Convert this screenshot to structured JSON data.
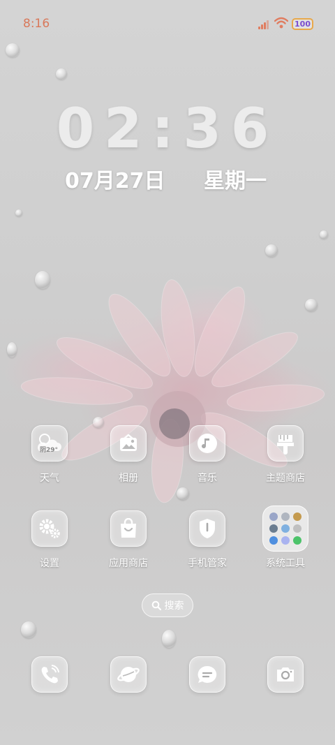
{
  "status_bar": {
    "time": "8:16",
    "battery": "100",
    "colors": {
      "time": "#d9795b",
      "signal": "#e07c5f",
      "wifi": "#e07c5f",
      "battery_border": "#e8a84a",
      "battery_text": "#7a4dd0"
    }
  },
  "lock": {
    "clock": "02:36",
    "date": "07月27日",
    "weekday": "星期一"
  },
  "weather_widget": {
    "temp": "29°",
    "condition": "阴"
  },
  "apps_row1": [
    {
      "label": "天气",
      "icon": "weather-icon"
    },
    {
      "label": "相册",
      "icon": "gallery-icon"
    },
    {
      "label": "音乐",
      "icon": "music-icon"
    },
    {
      "label": "主题商店",
      "icon": "theme-store-icon"
    }
  ],
  "apps_row2": [
    {
      "label": "设置",
      "icon": "gear-icon"
    },
    {
      "label": "应用商店",
      "icon": "app-store-icon"
    },
    {
      "label": "手机管家",
      "icon": "phone-manager-icon"
    },
    {
      "label": "系统工具",
      "icon": "folder-icon"
    }
  ],
  "search": {
    "label": "搜索",
    "icon": "search-icon"
  },
  "dock": [
    {
      "icon": "phone-icon"
    },
    {
      "icon": "browser-icon"
    },
    {
      "icon": "message-icon"
    },
    {
      "icon": "camera-icon"
    }
  ]
}
